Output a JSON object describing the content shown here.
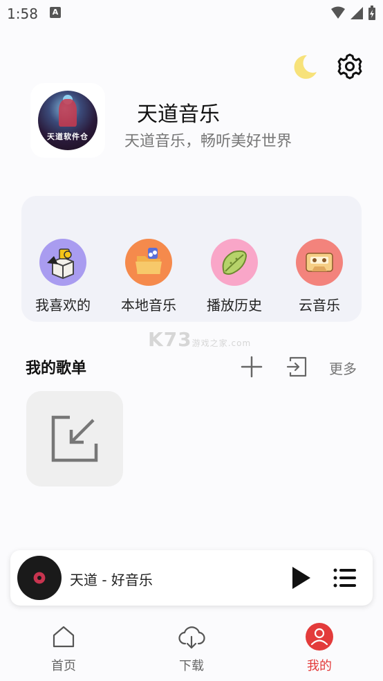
{
  "status_bar": {
    "time": "1:58",
    "notif_letter": "A"
  },
  "profile": {
    "title": "天道音乐",
    "subtitle": "天道音乐，畅听美好世界",
    "avatar_text": "天道软件仓"
  },
  "quick_access": [
    {
      "label": "我喜欢的",
      "icon": "favorite-box-icon",
      "bg": "#a99cf0"
    },
    {
      "label": "本地音乐",
      "icon": "local-folder-icon",
      "bg": "#f58a4c"
    },
    {
      "label": "播放历史",
      "icon": "history-leaf-icon",
      "bg": "#f9a6c8"
    },
    {
      "label": "云音乐",
      "icon": "cassette-icon",
      "bg": "#f3837c"
    }
  ],
  "watermark": {
    "main": "K73",
    "sub": "游戏之家",
    "domain": ".com"
  },
  "playlists": {
    "title": "我的歌单",
    "more_label": "更多"
  },
  "mini_player": {
    "song": "天道 - 好音乐"
  },
  "bottom_nav": [
    {
      "label": "首页",
      "icon": "home-icon",
      "active": false
    },
    {
      "label": "下载",
      "icon": "cloud-download-icon",
      "active": false
    },
    {
      "label": "我的",
      "icon": "profile-icon",
      "active": true
    }
  ],
  "colors": {
    "accent": "#e33b3b",
    "card_bg": "#f1f2f8",
    "moon": "#f7e27a"
  }
}
